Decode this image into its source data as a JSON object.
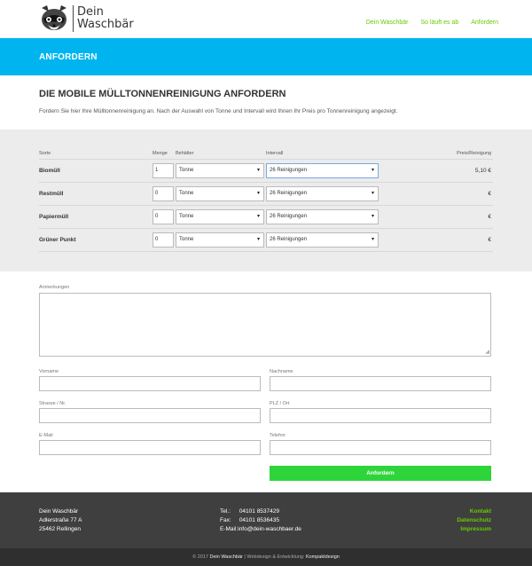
{
  "brand": {
    "line1": "Dein",
    "line2": "Waschbär"
  },
  "nav": {
    "items": [
      "Dein Waschbär",
      "So läuft es ab",
      "Anfordern"
    ]
  },
  "titlebar": {
    "title": "ANFORDERN"
  },
  "intro": {
    "heading": "DIE MOBILE MÜLLTONNENREINIGUNG ANFORDERN",
    "text": "Fordern Sie hier Ihre Mülltonnenreinigung an. Nach der Auswahl von Tonne und Intervall wird Ihnen Ihr Preis pro Tonnenreinigung angezeigt."
  },
  "order": {
    "headers": {
      "sorte": "Sorte",
      "menge": "Menge",
      "behaelter": "Behälter",
      "intervall": "Intervall",
      "preis": "Preis/Reinigung"
    },
    "caret": "▾",
    "rows": [
      {
        "label": "Biomüll",
        "qty": "1",
        "container": "Tonne",
        "interval": "26 Reinigungen",
        "price": "5,10  €"
      },
      {
        "label": "Restmüll",
        "qty": "0",
        "container": "Tonne",
        "interval": "26 Reinigungen",
        "price": "€"
      },
      {
        "label": "Papiermüll",
        "qty": "0",
        "container": "Tonne",
        "interval": "26 Reinigungen",
        "price": "€"
      },
      {
        "label": "Grüner Punkt",
        "qty": "0",
        "container": "Tonne",
        "interval": "26 Reinigungen",
        "price": "€"
      }
    ]
  },
  "form": {
    "anmerkungen": "Anmerkungen",
    "vorname": "Vorname",
    "nachname": "Nachname",
    "strasse": "Strasse / Nr.",
    "plz": "PLZ / Ort",
    "email": "E-Mail",
    "telefon": "Telefon",
    "submit": "Anfordern"
  },
  "footer": {
    "company": "Dein Waschbär",
    "street": "Adlerstraße 77 A",
    "city": "25462 Rellingen",
    "tel_label": "Tel.:",
    "tel": "04101 8537429",
    "fax_label": "Fax:",
    "fax": "04101 8536435",
    "email_line": "E-Mail:info@dein-waschbaer.de",
    "links": [
      "Kontakt",
      "Datenschutz",
      "Impressum"
    ]
  },
  "bottom": {
    "pre": "© 2017",
    "brand": "Dein Waschbär",
    "mid": "| Webdesign & Entwicklung:",
    "agency": "Kompaktdesign"
  },
  "colors": {
    "accent_blue": "#00b4f0",
    "accent_green": "#66cc00",
    "button_green": "#2ed53a",
    "footer_bg": "#3f3f3f"
  }
}
